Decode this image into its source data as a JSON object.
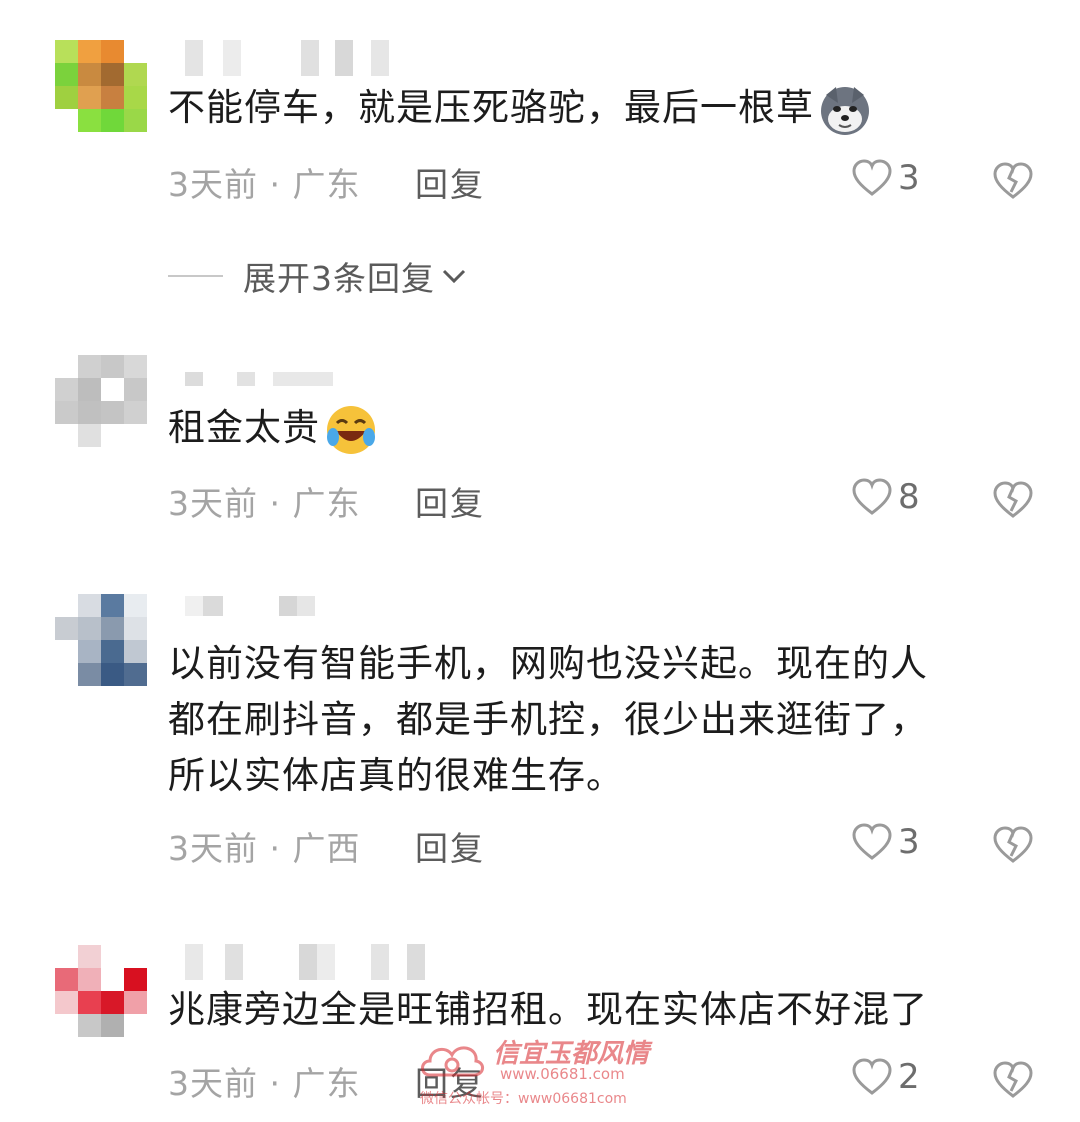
{
  "comments": [
    {
      "text": "不能停车，就是压死骆驼，最后一根草",
      "emoji": "husky-dog-emoji",
      "meta": "3天前 · 广东",
      "reply": "回复",
      "likes": "3",
      "expand": "展开3条回复"
    },
    {
      "text": "租金太贵",
      "emoji": "laugh-cry-emoji",
      "meta": "3天前 · 广东",
      "reply": "回复",
      "likes": "8"
    },
    {
      "text_lines": [
        "以前没有智能手机，网购也没兴起。现在的人",
        "都在刷抖音，都是手机控，很少出来逛街了，",
        "所以实体店真的很难生存。"
      ],
      "meta": "3天前 · 广西",
      "reply": "回复",
      "likes": "3"
    },
    {
      "text": "兆康旁边全是旺铺招租。现在实体店不好混了",
      "meta": "3天前 · 广东",
      "reply": "回复",
      "likes": "2"
    }
  ],
  "watermark": {
    "title": "信宜玉都风情",
    "url": "www.06681.com",
    "subtitle": "微信公众帐号：www06681com"
  },
  "colors": {
    "text": "#1c1c1c",
    "meta": "#a4a4a4",
    "icon": "#9a9a9a",
    "watermark": "#d8262c"
  }
}
